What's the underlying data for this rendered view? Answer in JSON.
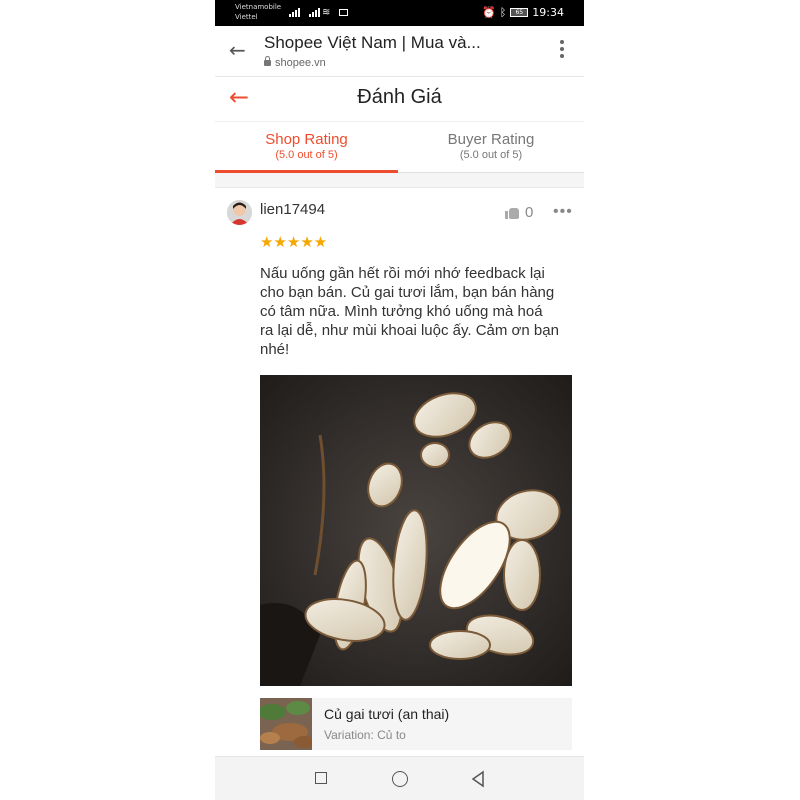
{
  "status_bar": {
    "carrier_line1": "Vietnamobile",
    "carrier_line2": "Viettel",
    "battery": "65",
    "time": "19:34"
  },
  "browser": {
    "title": "Shopee Việt Nam | Mua và...",
    "url": "shopee.vn"
  },
  "page": {
    "title": "Đánh Giá"
  },
  "tabs": [
    {
      "label": "Shop Rating",
      "sub": "(5.0 out of 5)",
      "active": true
    },
    {
      "label": "Buyer Rating",
      "sub": "(5.0 out of 5)",
      "active": false
    }
  ],
  "review": {
    "username": "lien17494",
    "likes": "0",
    "rating": 5,
    "stars": "★★★★★",
    "text": "Nấu uống gần hết rồi mới nhớ feedback lại cho bạn bán. Củ gai tươi lắm, bạn bán hàng có tâm nữa. Mình tưởng khó uống mà hoá ra lại dễ, như mùi khoai luộc ấy. Cảm ơn bạn nhé!"
  },
  "product": {
    "name": "Củ gai tươi (an thai)",
    "variation": "Variation: Củ to"
  },
  "colors": {
    "accent": "#ee4d2d",
    "star": "#f6a700"
  },
  "icons": {
    "browser_back": "arrow-left",
    "menu": "vertical-dots",
    "page_back": "arrow-left",
    "like": "thumbs-up",
    "more": "horizontal-dots"
  }
}
